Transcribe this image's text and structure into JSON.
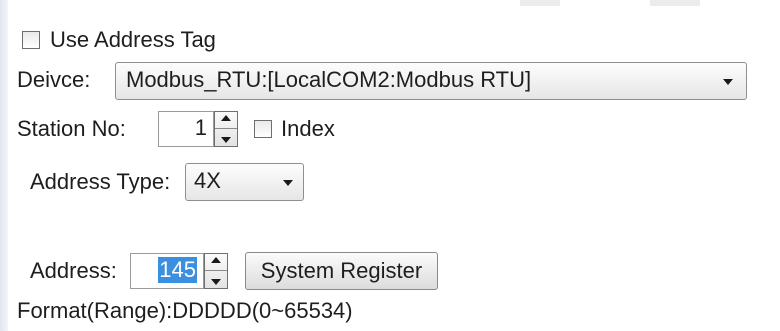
{
  "use_address_tag": {
    "label": "Use Address Tag",
    "checked": false
  },
  "device": {
    "label": "Deivce:",
    "value": "Modbus_RTU:[LocalCOM2:Modbus RTU]"
  },
  "station": {
    "label": "Station No:",
    "value": "1",
    "index_label": "Index",
    "index_checked": false
  },
  "address_type": {
    "label": "Address Type:",
    "value": "4X"
  },
  "address": {
    "label": "Address:",
    "value": "145",
    "system_register_label": "System Register"
  },
  "format": {
    "text": "Format(Range):DDDDD(0~65534)"
  },
  "colors": {
    "selection": "#3b8fe0",
    "border": "#8f8f8f",
    "text": "#1e1e1e"
  },
  "icons": {
    "spinner": "up-down-spinner-icon",
    "dropdown": "chevron-down-icon"
  }
}
